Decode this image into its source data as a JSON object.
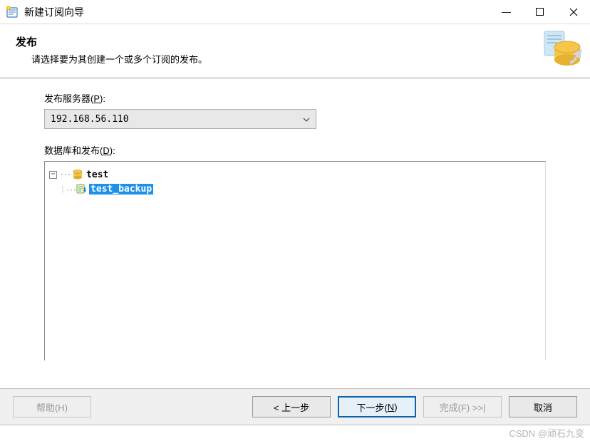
{
  "window": {
    "title": "新建订阅向导"
  },
  "header": {
    "title": "发布",
    "description": "请选择要为其创建一个或多个订阅的发布。"
  },
  "fields": {
    "publisher_label": "发布服务器(",
    "publisher_key": "P",
    "publisher_suffix": "):",
    "publisher_value": "192.168.56.110",
    "db_label": "数据库和发布(",
    "db_key": "D",
    "db_suffix": "):"
  },
  "tree": {
    "root_label": "test",
    "child_label": "test_backup"
  },
  "buttons": {
    "help": "帮助(H)",
    "back": "< 上一步",
    "next": "下一步(",
    "next_key": "N",
    "next_suffix": ")",
    "finish": "完成(F) >>|",
    "cancel": "取消"
  },
  "watermark": "CSDN @顽石九变"
}
